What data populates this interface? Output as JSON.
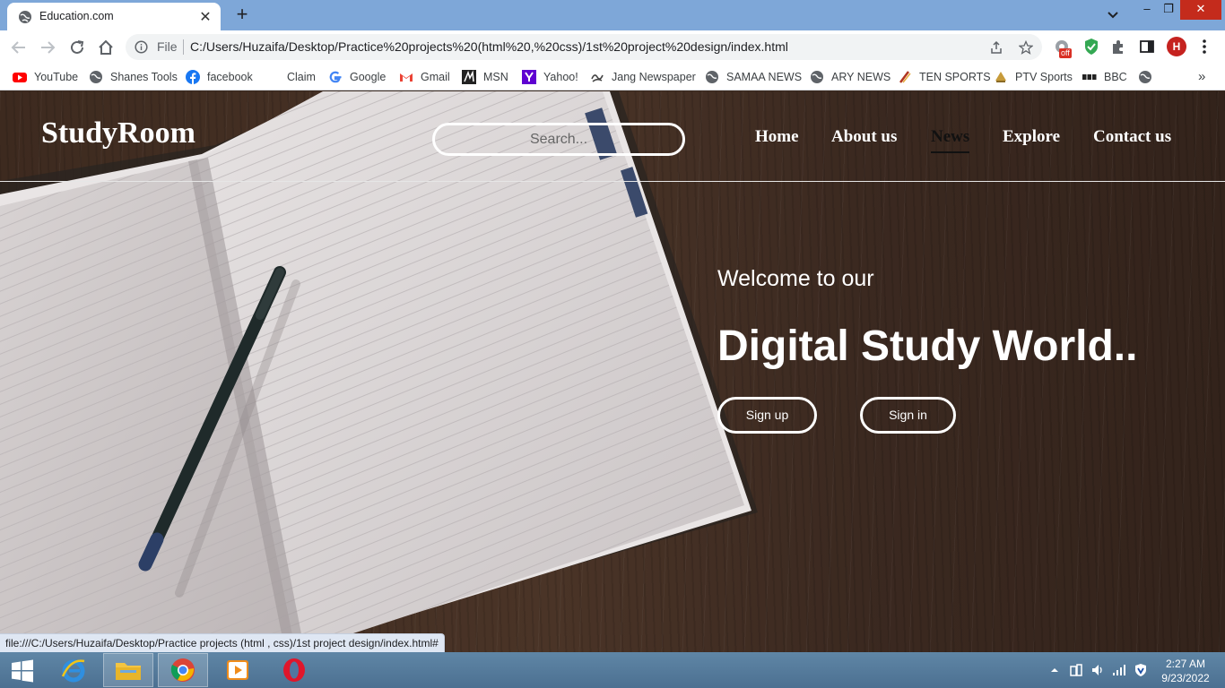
{
  "browser": {
    "tab_title": "Education.com",
    "new_tab_symbol": "+",
    "close_symbol": "✕",
    "window": {
      "minimize": "–",
      "maximize": "❐",
      "close": "✕"
    },
    "omnibox": {
      "scheme_label": "File",
      "url": "C:/Users/Huzaifa/Desktop/Practice%20projects%20(html%20,%20css)/1st%20project%20design/index.html"
    },
    "extension_badge": "off",
    "profile_initial": "H",
    "bookmarks": [
      {
        "label": "YouTube",
        "icon": "youtube-icon"
      },
      {
        "label": "Shanes Tools",
        "icon": "globe-icon"
      },
      {
        "label": "facebook",
        "icon": "facebook-icon"
      },
      {
        "label": "Claim",
        "icon": "blank-icon"
      },
      {
        "label": "Google",
        "icon": "google-icon"
      },
      {
        "label": "Gmail",
        "icon": "gmail-icon"
      },
      {
        "label": "MSN",
        "icon": "msn-icon"
      },
      {
        "label": "Yahoo!",
        "icon": "yahoo-icon"
      },
      {
        "label": "Jang Newspaper",
        "icon": "jang-icon"
      },
      {
        "label": "SAMAA NEWS",
        "icon": "globe-icon"
      },
      {
        "label": "ARY NEWS",
        "icon": "globe-icon"
      },
      {
        "label": "TEN SPORTS",
        "icon": "tensports-icon"
      },
      {
        "label": "PTV Sports",
        "icon": "ptv-icon"
      },
      {
        "label": "BBC",
        "icon": "bbc-icon"
      }
    ],
    "bookmarks_more": "»",
    "status_url": "file:///C:/Users/Huzaifa/Desktop/Practice projects (html , css)/1st project design/index.html#"
  },
  "site": {
    "logo": "StudyRoom",
    "search_placeholder": "Search...",
    "nav": [
      {
        "label": "Home",
        "active": false
      },
      {
        "label": "About us",
        "active": false
      },
      {
        "label": "News",
        "active": true
      },
      {
        "label": "Explore",
        "active": false
      },
      {
        "label": "Contact us",
        "active": false
      }
    ],
    "hero": {
      "welcome": "Welcome to our",
      "headline": "Digital Study World..",
      "signup": "Sign up",
      "signin": "Sign in"
    }
  },
  "taskbar": {
    "apps": [
      "internet-explorer",
      "file-explorer",
      "chrome",
      "media-player",
      "opera"
    ],
    "time": "2:27 AM",
    "date": "9/23/2022"
  },
  "colors": {
    "tabstrip": "#7ea7d8",
    "close_red": "#c42b1c",
    "wood_dark": "#3d2a1f",
    "taskbar": "#5579a0"
  }
}
